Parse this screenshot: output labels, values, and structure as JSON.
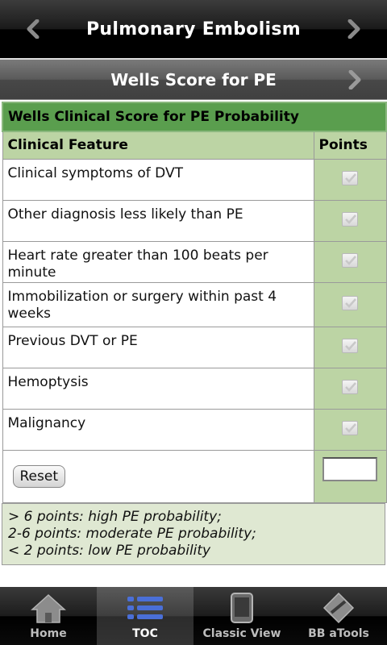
{
  "header": {
    "title": "Pulmonary Embolism"
  },
  "subheader": {
    "title": "Wells Score for PE"
  },
  "table": {
    "caption": "Wells Clinical Score for PE Probability",
    "col_feature": "Clinical Feature",
    "col_points": "Points",
    "rows": [
      {
        "label": "Clinical symptoms of DVT",
        "checked": true
      },
      {
        "label": "Other diagnosis less likely than PE",
        "checked": true
      },
      {
        "label": "Heart rate greater than 100 beats per minute",
        "checked": true
      },
      {
        "label": "Immobilization or surgery within past 4 weeks",
        "checked": true
      },
      {
        "label": "Previous DVT or PE",
        "checked": true
      },
      {
        "label": "Hemoptysis",
        "checked": true
      },
      {
        "label": "Malignancy",
        "checked": true
      }
    ],
    "reset_label": "Reset",
    "score_value": ""
  },
  "interpretation": [
    "> 6 points: high PE probability;",
    "2-6 points: moderate PE probability;",
    "< 2 points: low PE probability"
  ],
  "tabs": [
    {
      "label": "Home",
      "icon": "home-icon",
      "active": false
    },
    {
      "label": "TOC",
      "icon": "list-icon",
      "active": true
    },
    {
      "label": "Classic View",
      "icon": "phone-icon",
      "active": false
    },
    {
      "label": "BB aTools",
      "icon": "tools-icon",
      "active": false
    }
  ],
  "colors": {
    "caption_bg": "#5a9e4e",
    "col_bg": "#bcd4a4",
    "interp_bg": "#dfe8d2"
  }
}
